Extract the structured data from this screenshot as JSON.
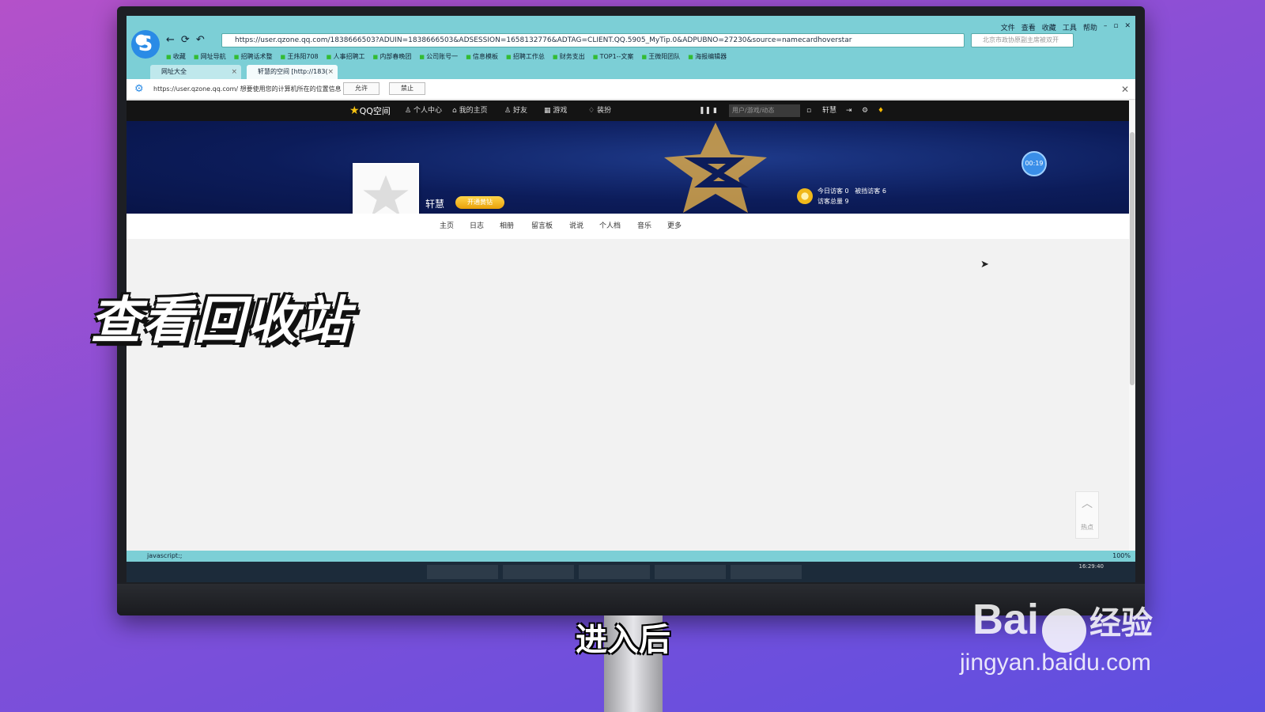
{
  "browser": {
    "url": "https://user.qzone.qq.com/1838666503?ADUIN=1838666503&ADSESSION=1658132776&ADTAG=CLIENT.QQ.5905_MyTip.0&ADPUBNO=27230&source=namecardhoverstar",
    "menu": [
      "文件",
      "查看",
      "收藏",
      "工具",
      "帮助"
    ],
    "search_placeholder": "北京市政协原副主席被双开",
    "bookmarks": [
      "收藏",
      "网址导航",
      "招聘话术整",
      "王炜阳708",
      "人事招聘工",
      "内部春晚团",
      "公司账号一",
      "信息模板",
      "招聘工作总",
      "财务支出",
      "TOP1--文案",
      "王微阳团队",
      "海报编辑器"
    ],
    "tabs": [
      {
        "label": "网址大全"
      },
      {
        "label": "轩慧的空间 [http://183("
      }
    ],
    "infobar": {
      "message": "https://user.qzone.qq.com/ 想要使用您的计算机所在的位置信息",
      "allow": "允许",
      "deny": "禁止"
    },
    "status_text": "javascript:;",
    "zoom": "100%",
    "clock": "16:29:40"
  },
  "qzone": {
    "logo": "QQ空间",
    "nav": [
      "个人中心",
      "我的主页",
      "好友",
      "游戏",
      "装扮"
    ],
    "search_placeholder": "用户/游戏/动态",
    "user_short": "轩慧",
    "username": "轩慧",
    "vip_label": "开通黄钻",
    "visitors": {
      "today": "今日访客 0",
      "blocked": "被挡访客 6",
      "total": "访客总量 9"
    },
    "timer": "00:19",
    "subnav": [
      "主页",
      "日志",
      "相册",
      "留言板",
      "说说",
      "个人档",
      "音乐",
      "更多"
    ],
    "hot_label": "热点"
  },
  "overlay": {
    "title": "查看回收站",
    "caption": "进入后"
  },
  "watermark": {
    "brand": "Bai",
    "suffix": "经验",
    "url": "jingyan.baidu.com"
  }
}
